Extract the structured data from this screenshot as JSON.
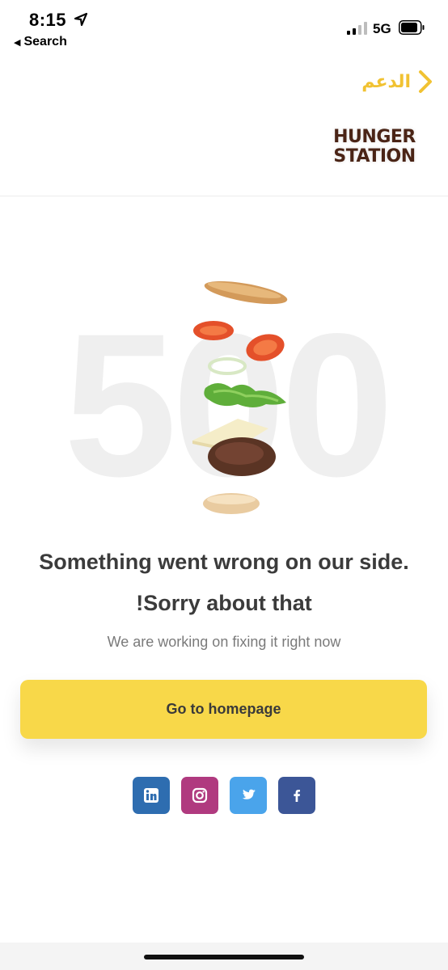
{
  "status_bar": {
    "time": "8:15",
    "back_app": "Search",
    "network": "5G",
    "icons": [
      "location-arrow-icon",
      "signal-bars-icon",
      "battery-icon"
    ]
  },
  "header": {
    "support_label": "الدعم",
    "logo_line1": "HUNGER",
    "logo_line2": "STATION"
  },
  "error": {
    "code": "500",
    "headline": "Something went wrong on our side.",
    "subheadline": "!Sorry about that",
    "body": "We are working on fixing it right now"
  },
  "cta": {
    "home_label": "Go to homepage",
    "color": "#f8d849"
  },
  "socials": [
    {
      "name": "linkedin",
      "icon": "linkedin-icon",
      "color": "#2e6db0"
    },
    {
      "name": "instagram",
      "icon": "instagram-icon",
      "color": "#b03a7f"
    },
    {
      "name": "twitter",
      "icon": "twitter-icon",
      "color": "#4aa4eb"
    },
    {
      "name": "facebook",
      "icon": "facebook-icon",
      "color": "#3c5697"
    }
  ],
  "colors": {
    "accent": "#f1c232",
    "text": "#3b3b3b",
    "muted": "#7a7a7a",
    "watermark": "#efefef"
  }
}
